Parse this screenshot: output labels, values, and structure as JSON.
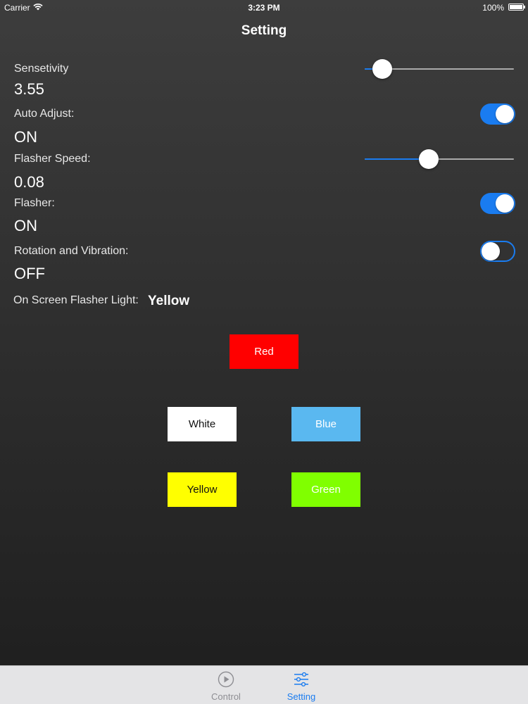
{
  "status_bar": {
    "carrier": "Carrier",
    "time": "3:23 PM",
    "battery": "100%",
    "wifi_icon": "wifi-icon",
    "battery_icon": "battery-icon"
  },
  "nav": {
    "title": "Setting"
  },
  "settings": {
    "sensitivity": {
      "label": "Sensetivity",
      "value": "3.55",
      "slider_fraction": 0.12
    },
    "auto_adjust": {
      "label": "Auto Adjust:",
      "value": "ON",
      "switch_on": true
    },
    "flasher_speed": {
      "label": "Flasher Speed:",
      "value": "0.08",
      "slider_fraction": 0.43
    },
    "flasher": {
      "label": "Flasher:",
      "value": "ON",
      "switch_on": true
    },
    "rotation_vibration": {
      "label": "Rotation and Vibration:",
      "value": "OFF",
      "switch_on": false
    },
    "on_screen_flasher": {
      "label": "On Screen Flasher Light:",
      "value": "Yellow"
    }
  },
  "color_buttons": {
    "red": {
      "label": "Red",
      "bg": "#ff0000",
      "fg": "#ffffff"
    },
    "white": {
      "label": "White",
      "bg": "#ffffff",
      "fg": "#111111"
    },
    "blue": {
      "label": "Blue",
      "bg": "#5ab8f0",
      "fg": "#ffffff"
    },
    "yellow": {
      "label": "Yellow",
      "bg": "#ffff00",
      "fg": "#111111"
    },
    "green": {
      "label": "Green",
      "bg": "#80ff00",
      "fg": "#ffffff"
    }
  },
  "tab_bar": {
    "tabs": [
      {
        "label": "Control",
        "icon": "play-circle-icon",
        "active": false
      },
      {
        "label": "Setting",
        "icon": "sliders-icon",
        "active": true
      }
    ]
  },
  "colors": {
    "accent": "#1a7cf0",
    "tab_inactive": "#8e8e93"
  }
}
